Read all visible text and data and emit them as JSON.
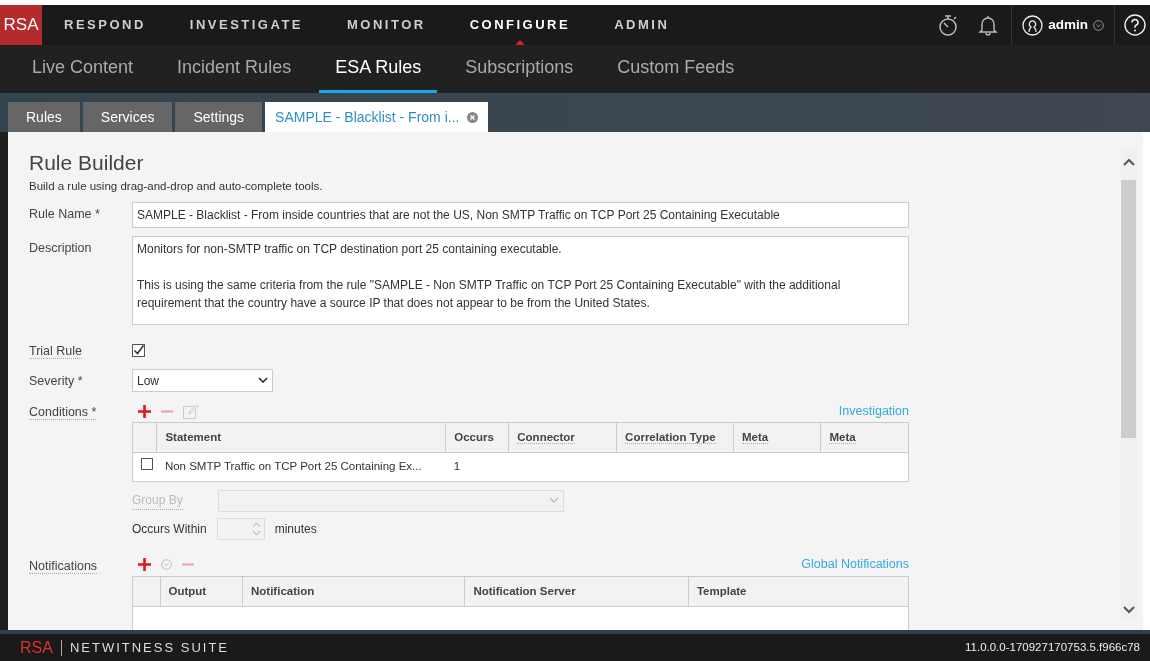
{
  "top_nav": {
    "logo": "RSA",
    "items": [
      {
        "label": "RESPOND",
        "selected": false
      },
      {
        "label": "INVESTIGATE",
        "selected": false
      },
      {
        "label": "MONITOR",
        "selected": false
      },
      {
        "label": "CONFIGURE",
        "selected": true
      },
      {
        "label": "ADMIN",
        "selected": false
      }
    ],
    "user": "admin"
  },
  "sub_nav": {
    "items": [
      {
        "label": "Live Content",
        "selected": false
      },
      {
        "label": "Incident Rules",
        "selected": false
      },
      {
        "label": "ESA Rules",
        "selected": true
      },
      {
        "label": "Subscriptions",
        "selected": false
      },
      {
        "label": "Custom Feeds",
        "selected": false
      }
    ]
  },
  "tabs": [
    {
      "label": "Rules",
      "selected": false,
      "closable": false
    },
    {
      "label": "Services",
      "selected": false,
      "closable": false
    },
    {
      "label": "Settings",
      "selected": false,
      "closable": false
    },
    {
      "label": "SAMPLE - Blacklist - From i...",
      "selected": true,
      "closable": true
    }
  ],
  "form": {
    "title": "Rule Builder",
    "subtitle": "Build a rule using drag-and-drop and auto-complete tools.",
    "rule_name_label": "Rule Name *",
    "rule_name": "SAMPLE - Blacklist - From inside countries that are not the US, Non SMTP Traffic on TCP Port 25 Containing Executable",
    "description_label": "Description",
    "description": "Monitors for non-SMTP traffic on TCP destination port 25 containing executable.\n\nThis is using the same criteria from the rule \"SAMPLE - Non SMTP Traffic on TCP Port 25 Containing Executable\" with the additional requirement that the country have a source IP that does not appear to be from the United States.",
    "trial_rule_label": "Trial Rule",
    "trial_rule_checked": true,
    "severity_label": "Severity *",
    "severity": "Low"
  },
  "conditions": {
    "label": "Conditions *",
    "link": "Investigation",
    "columns": [
      "Statement",
      "Occurs",
      "Connector",
      "Correlation Type",
      "Meta",
      "Meta"
    ],
    "rows": [
      {
        "checked": false,
        "statement": "Non SMTP Traffic on TCP Port 25 Containing Ex...",
        "occurs": "1"
      }
    ],
    "group_by_label": "Group By",
    "group_by_disabled": true,
    "occurs_within_label": "Occurs Within",
    "minutes_label": "minutes"
  },
  "notifications": {
    "label": "Notifications",
    "link": "Global Notifications",
    "columns": [
      "Output",
      "Notification",
      "Notification Server",
      "Template"
    ]
  },
  "footer": {
    "brand": "RSA",
    "product": "NETWITNESS SUITE",
    "version": "11.0.0.0-170927170753.5.f966c78"
  }
}
